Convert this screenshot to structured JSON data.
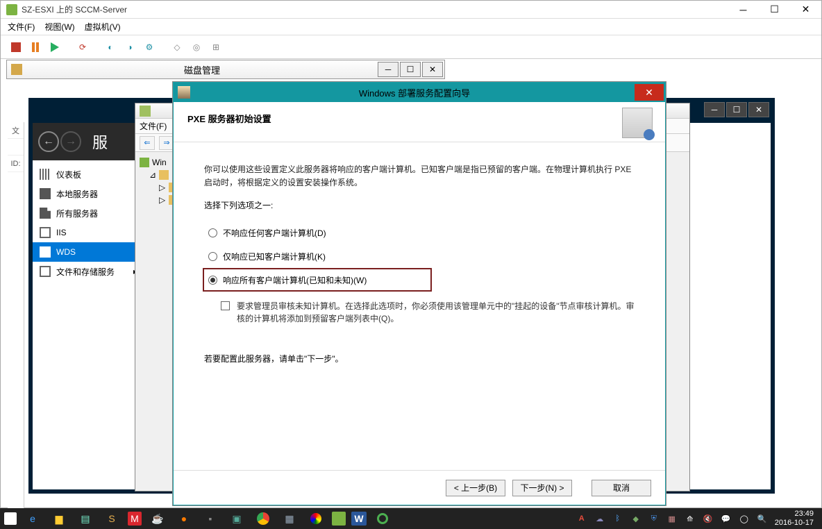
{
  "vmware": {
    "title": "SZ-ESXI 上的 SCCM-Server",
    "menu": {
      "file": "文件(F)",
      "view": "视图(W)",
      "vm": "虚拟机(V)"
    }
  },
  "disk": {
    "title": "磁盘管理"
  },
  "server": {
    "header": "服",
    "sidebar": [
      {
        "label": "仪表板",
        "icon": "dash"
      },
      {
        "label": "本地服务器",
        "icon": "local"
      },
      {
        "label": "所有服务器",
        "icon": "all"
      },
      {
        "label": "IIS",
        "icon": "iis"
      },
      {
        "label": "WDS",
        "icon": "wds",
        "active": true
      },
      {
        "label": "文件和存储服务",
        "icon": "files"
      }
    ]
  },
  "wds": {
    "menu_file": "文件(F)",
    "tree_root": "Win"
  },
  "wizard": {
    "title": "Windows 部署服务配置向导",
    "page_title": "PXE 服务器初始设置",
    "desc": "你可以使用这些设置定义此服务器将响应的客户端计算机。已知客户端是指已预留的客户端。在物理计算机执行 PXE 启动时，将根据定义的设置安装操作系统。",
    "select_label": "选择下列选项之一:",
    "options": [
      {
        "label": "不响应任何客户端计算机(D)",
        "checked": false
      },
      {
        "label": "仅响应已知客户端计算机(K)",
        "checked": false
      },
      {
        "label": "响应所有客户端计算机(已知和未知)(W)",
        "checked": true,
        "highlight": true
      }
    ],
    "checkbox": "要求管理员审核未知计算机。在选择此选项时，你必须使用该管理单元中的\"挂起的设备\"节点审核计算机。审核的计算机将添加到预留客户端列表中(Q)。",
    "foot": "若要配置此服务器，请单击\"下一步\"。",
    "btn_back": "< 上一步(B)",
    "btn_next": "下一步(N) >",
    "btn_cancel": "取消"
  },
  "left_strip": [
    "文",
    "",
    "ID:"
  ],
  "taskbar": {
    "time": "23:49",
    "date": "2016-10-17"
  }
}
